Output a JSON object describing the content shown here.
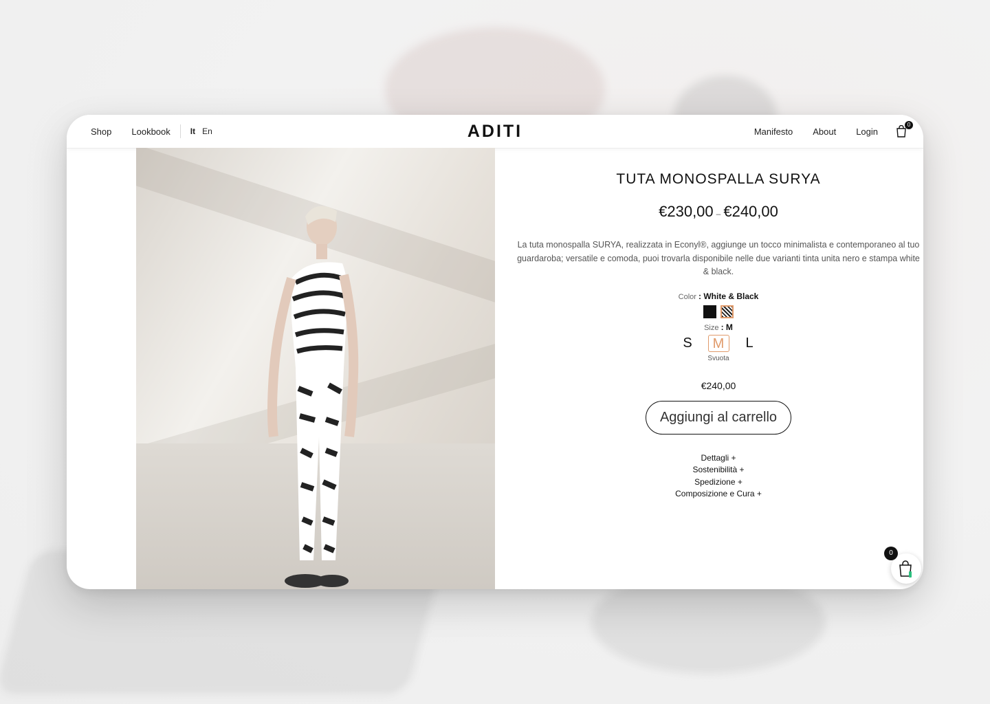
{
  "nav": {
    "left_links": [
      "Shop",
      "Lookbook"
    ],
    "languages": [
      {
        "label": "It",
        "active": true
      },
      {
        "label": "En",
        "active": false
      }
    ],
    "logo": "ADITI",
    "right_links": [
      "Manifesto",
      "About",
      "Login"
    ],
    "cart_count": "0",
    "cart_icon": "shopping-bag-icon"
  },
  "product": {
    "image_icon": "model-photo",
    "title": "TUTA MONOSPALLA SURYA",
    "price_min": "€230,00",
    "price_sep": "–",
    "price_max": "€240,00",
    "description": "La tuta monospalla SURYA, realizzata in Econyl®,  aggiunge un tocco minimalista e contemporaneo al tuo guardaroba; versatile e comoda, puoi trovarla disponibile  nelle due varianti tinta unita nero e stampa white & black.",
    "color_label": "Color",
    "color_value": ": White & Black",
    "colors": [
      {
        "name": "black",
        "selected": false
      },
      {
        "name": "white-black-pattern",
        "selected": true
      }
    ],
    "size_label": "Size",
    "size_value": ": M",
    "sizes": [
      {
        "label": "S",
        "selected": false
      },
      {
        "label": "M",
        "selected": true
      },
      {
        "label": "L",
        "selected": false
      }
    ],
    "reset_label": "Svuota",
    "variant_price": "€240,00",
    "add_to_cart": "Aggiungi al carrello",
    "accordions": [
      "Dettagli +",
      "Sostenibilità +",
      "Spedizione +",
      "Composizione e Cura +"
    ],
    "accent_color": "#e09a6a"
  },
  "floating_cart": {
    "count": "0"
  }
}
